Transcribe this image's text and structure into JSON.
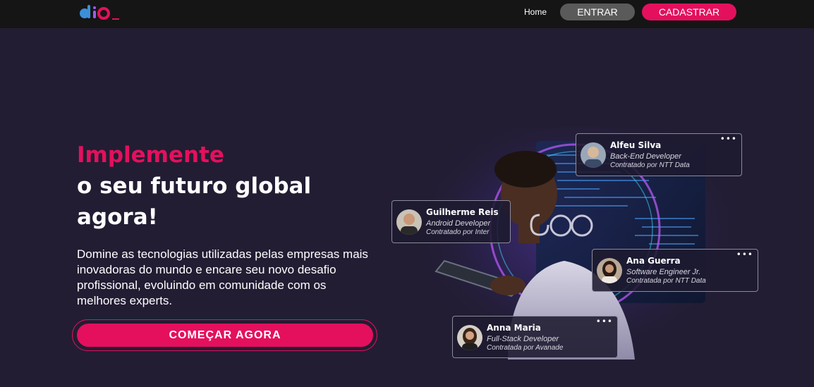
{
  "nav": {
    "home": "Home",
    "login": "ENTRAR",
    "signup": "CADASTRAR"
  },
  "hero": {
    "title_accent": "Implemente",
    "title_line2": "o seu futuro global",
    "title_line3": "agora!",
    "description": "Domine as tecnologias utilizadas pelas empresas mais inovadoras do mundo e encare seu novo desafio profissional, evoluindo em comunidade com os melhores experts.",
    "cta": "COMEÇAR AGORA"
  },
  "cards": [
    {
      "name": "Alfeu Silva",
      "role": "Back-End Developer",
      "company": "Contratado por NTT Data"
    },
    {
      "name": "Guilherme Reis",
      "role": "Android Developer",
      "company": "Contratado por Inter"
    },
    {
      "name": "Ana Guerra",
      "role": "Software Engineer Jr.",
      "company": "Contratada por NTT Data"
    },
    {
      "name": "Anna Maria",
      "role": "Full-Stack Developer",
      "company": "Contratada por Avanade"
    }
  ],
  "colors": {
    "accent": "#e4105d",
    "background": "#221d33",
    "navbar": "#151515",
    "login_button": "#5a5a5a"
  },
  "icons": {
    "logo": "dio-logo",
    "card_menu": "more-dots-icon"
  }
}
